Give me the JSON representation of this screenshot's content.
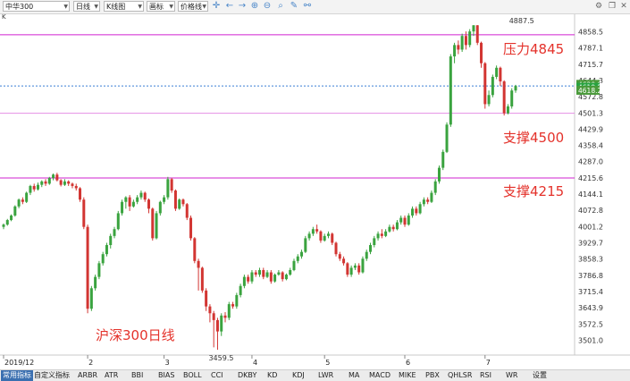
{
  "toolbar": {
    "symbol": "中华300",
    "period": "日线",
    "chart_type": "K线图",
    "indicator": "画标",
    "price_mode": "价格线"
  },
  "panel_label": "K",
  "bottom_tabs": [
    "常用指标",
    "自定义指标",
    "ARBR",
    "ATR",
    "BBI",
    "BIAS",
    "BOLL",
    "CCI",
    "DKBY",
    "KD",
    "KDJ",
    "LWR",
    "MA",
    "MACD",
    "MIKE",
    "PBX",
    "QHLSR",
    "RSI",
    "WR",
    "设置"
  ],
  "chart_data": {
    "type": "candlestick",
    "title": "沪深300日线",
    "y_range": [
      3480,
      4880
    ],
    "y_ticks": [
      4858.5,
      4787.1,
      4715.7,
      4644.3,
      4572.8,
      4501.3,
      4429.9,
      4358.4,
      4287.0,
      4215.6,
      4144.1,
      4072.8,
      4001.2,
      3929.7,
      3858.3,
      3786.8,
      3715.4,
      3643.9,
      3572.5,
      3501.0
    ],
    "x_labels": [
      {
        "label": "2019/12",
        "index": 0
      },
      {
        "label": "2",
        "index": 22
      },
      {
        "label": "3",
        "index": 42
      },
      {
        "label": "4",
        "index": 65
      },
      {
        "label": "5",
        "index": 84
      },
      {
        "label": "6",
        "index": 105
      },
      {
        "label": "7",
        "index": 126
      }
    ],
    "horizontal_lines": [
      {
        "price": 4845,
        "label": "压力4845",
        "color": "#d020d0"
      },
      {
        "price": 4500,
        "label": "支撑4500",
        "color": "#e58ee5"
      },
      {
        "price": 4215,
        "label": "支撑4215",
        "color": "#d020d0"
      }
    ],
    "current_line": {
      "price": 4620.0,
      "color": "#3a7fd5"
    },
    "price_tags": [
      {
        "text": "4620.8",
        "price": 4627,
        "color": "#4a9a3a"
      },
      {
        "text": "4619.5",
        "price": 4614,
        "color": "#27a340"
      },
      {
        "text": "4618.2",
        "price": 4601,
        "color": "#4a9a3a"
      }
    ],
    "high_label": {
      "text": "4887.5",
      "index": 133,
      "price": 4887.5
    },
    "low_label": {
      "text": "3459.5",
      "index": 56,
      "price": 3459.5
    },
    "colors": {
      "up": "#3aa33f",
      "down": "#d23532"
    },
    "candles": [
      [
        4000,
        4010,
        3990,
        4015
      ],
      [
        4010,
        4030,
        4005,
        4035
      ],
      [
        4030,
        4050,
        4025,
        4055
      ],
      [
        4050,
        4090,
        4045,
        4095
      ],
      [
        4090,
        4120,
        4082,
        4125
      ],
      [
        4120,
        4110,
        4100,
        4130
      ],
      [
        4110,
        4150,
        4105,
        4155
      ],
      [
        4150,
        4180,
        4140,
        4185
      ],
      [
        4180,
        4165,
        4155,
        4190
      ],
      [
        4165,
        4185,
        4160,
        4195
      ],
      [
        4185,
        4200,
        4175,
        4205
      ],
      [
        4200,
        4190,
        4180,
        4210
      ],
      [
        4190,
        4215,
        4185,
        4220
      ],
      [
        4215,
        4230,
        4205,
        4235
      ],
      [
        4230,
        4205,
        4200,
        4238
      ],
      [
        4205,
        4185,
        4178,
        4210
      ],
      [
        4185,
        4200,
        4180,
        4210
      ],
      [
        4200,
        4190,
        4180,
        4205
      ],
      [
        4190,
        4180,
        4170,
        4195
      ],
      [
        4180,
        4170,
        4160,
        4190
      ],
      [
        4170,
        4120,
        4110,
        4175
      ],
      [
        4120,
        4000,
        3990,
        4130
      ],
      [
        4000,
        3640,
        3620,
        4010
      ],
      [
        3640,
        3730,
        3630,
        3740
      ],
      [
        3730,
        3780,
        3720,
        3790
      ],
      [
        3780,
        3840,
        3770,
        3850
      ],
      [
        3840,
        3880,
        3830,
        3890
      ],
      [
        3880,
        3920,
        3870,
        3930
      ],
      [
        3920,
        3960,
        3905,
        3970
      ],
      [
        3960,
        3990,
        3950,
        4000
      ],
      [
        3990,
        4060,
        3985,
        4070
      ],
      [
        4060,
        4110,
        4050,
        4120
      ],
      [
        4110,
        4130,
        4080,
        4135
      ],
      [
        4130,
        4090,
        4070,
        4140
      ],
      [
        4090,
        4110,
        4085,
        4120
      ],
      [
        4110,
        4130,
        4100,
        4140
      ],
      [
        4130,
        4150,
        4120,
        4160
      ],
      [
        4150,
        4120,
        4110,
        4155
      ],
      [
        4120,
        4080,
        4060,
        4125
      ],
      [
        4080,
        3950,
        3940,
        4085
      ],
      [
        3950,
        4060,
        3945,
        4070
      ],
      [
        4060,
        4110,
        4050,
        4115
      ],
      [
        4110,
        4130,
        4100,
        4140
      ],
      [
        4130,
        4210,
        4120,
        4220
      ],
      [
        4210,
        4160,
        4150,
        4215
      ],
      [
        4160,
        4080,
        4070,
        4165
      ],
      [
        4080,
        4120,
        4075,
        4125
      ],
      [
        4120,
        4100,
        4090,
        4125
      ],
      [
        4100,
        4040,
        4030,
        4105
      ],
      [
        4040,
        3950,
        3940,
        4050
      ],
      [
        3950,
        3850,
        3840,
        3955
      ],
      [
        3850,
        3820,
        3720,
        3860
      ],
      [
        3820,
        3720,
        3710,
        3825
      ],
      [
        3720,
        3650,
        3630,
        3730
      ],
      [
        3650,
        3620,
        3580,
        3660
      ],
      [
        3620,
        3590,
        3470,
        3630
      ],
      [
        3590,
        3540,
        3459.5,
        3600
      ],
      [
        3540,
        3610,
        3520,
        3620
      ],
      [
        3610,
        3600,
        3580,
        3625
      ],
      [
        3600,
        3660,
        3590,
        3670
      ],
      [
        3660,
        3650,
        3640,
        3670
      ],
      [
        3650,
        3700,
        3640,
        3710
      ],
      [
        3700,
        3740,
        3690,
        3750
      ],
      [
        3740,
        3780,
        3730,
        3790
      ],
      [
        3780,
        3760,
        3750,
        3790
      ],
      [
        3760,
        3800,
        3750,
        3810
      ],
      [
        3800,
        3790,
        3780,
        3810
      ],
      [
        3790,
        3810,
        3780,
        3820
      ],
      [
        3810,
        3780,
        3770,
        3820
      ],
      [
        3780,
        3800,
        3775,
        3810
      ],
      [
        3800,
        3760,
        3750,
        3810
      ],
      [
        3760,
        3790,
        3755,
        3795
      ],
      [
        3790,
        3800,
        3785,
        3810
      ],
      [
        3800,
        3770,
        3760,
        3805
      ],
      [
        3770,
        3790,
        3765,
        3795
      ],
      [
        3790,
        3810,
        3785,
        3820
      ],
      [
        3810,
        3850,
        3805,
        3860
      ],
      [
        3850,
        3870,
        3840,
        3880
      ],
      [
        3870,
        3890,
        3860,
        3900
      ],
      [
        3890,
        3950,
        3885,
        3960
      ],
      [
        3950,
        3970,
        3940,
        3980
      ],
      [
        3970,
        3990,
        3960,
        4000
      ],
      [
        3990,
        3980,
        3970,
        4010
      ],
      [
        3980,
        3940,
        3930,
        3985
      ],
      [
        3940,
        3960,
        3935,
        3970
      ],
      [
        3960,
        3970,
        3950,
        3980
      ],
      [
        3970,
        3930,
        3920,
        3975
      ],
      [
        3930,
        3880,
        3870,
        3935
      ],
      [
        3880,
        3860,
        3850,
        3890
      ],
      [
        3860,
        3840,
        3830,
        3870
      ],
      [
        3840,
        3790,
        3780,
        3845
      ],
      [
        3790,
        3820,
        3780,
        3830
      ],
      [
        3820,
        3830,
        3810,
        3840
      ],
      [
        3830,
        3800,
        3790,
        3840
      ],
      [
        3800,
        3860,
        3795,
        3870
      ],
      [
        3860,
        3890,
        3850,
        3900
      ],
      [
        3890,
        3920,
        3880,
        3930
      ],
      [
        3920,
        3950,
        3910,
        3960
      ],
      [
        3950,
        3970,
        3940,
        3980
      ],
      [
        3970,
        3960,
        3950,
        3990
      ],
      [
        3960,
        3980,
        3955,
        3990
      ],
      [
        3980,
        4000,
        3975,
        4010
      ],
      [
        4000,
        3990,
        3980,
        4010
      ],
      [
        3990,
        4020,
        3985,
        4030
      ],
      [
        4020,
        4040,
        4010,
        4050
      ],
      [
        4040,
        4010,
        4000,
        4050
      ],
      [
        4010,
        4050,
        4005,
        4060
      ],
      [
        4050,
        4080,
        4040,
        4090
      ],
      [
        4080,
        4060,
        4050,
        4090
      ],
      [
        4060,
        4100,
        4055,
        4110
      ],
      [
        4100,
        4120,
        4090,
        4130
      ],
      [
        4120,
        4110,
        4100,
        4130
      ],
      [
        4110,
        4150,
        4105,
        4160
      ],
      [
        4150,
        4200,
        4140,
        4210
      ],
      [
        4200,
        4260,
        4190,
        4270
      ],
      [
        4260,
        4330,
        4250,
        4340
      ],
      [
        4330,
        4450,
        4325,
        4460
      ],
      [
        4450,
        4750,
        4440,
        4760
      ],
      [
        4750,
        4800,
        4720,
        4810
      ],
      [
        4800,
        4780,
        4760,
        4820
      ],
      [
        4780,
        4840,
        4770,
        4850
      ],
      [
        4840,
        4800,
        4780,
        4860
      ],
      [
        4800,
        4860,
        4790,
        4870
      ],
      [
        4860,
        4887,
        4840,
        4887.5
      ],
      [
        4887,
        4810,
        4800,
        4887.5
      ],
      [
        4810,
        4720,
        4700,
        4815
      ],
      [
        4720,
        4540,
        4520,
        4725
      ],
      [
        4540,
        4580,
        4530,
        4600
      ],
      [
        4580,
        4660,
        4570,
        4670
      ],
      [
        4660,
        4700,
        4650,
        4710
      ],
      [
        4700,
        4640,
        4620,
        4705
      ],
      [
        4640,
        4500,
        4490,
        4645
      ],
      [
        4500,
        4530,
        4495,
        4540
      ],
      [
        4530,
        4600,
        4520,
        4610
      ],
      [
        4600,
        4620,
        4590,
        4625
      ]
    ]
  }
}
